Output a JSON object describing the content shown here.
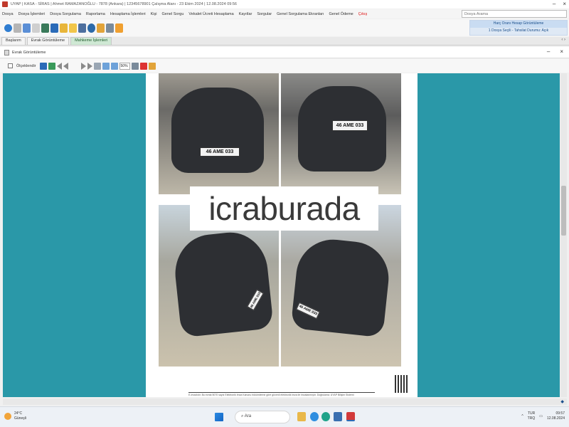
{
  "window": {
    "title": "UYAP | KASA - SİRAS | Ahmet RAMAZANOĞLU - 7878 (Ankara) | 12345678901 Çalışma Alanı - 23 Ekim 2024 | 12.08.2024 09:56"
  },
  "menu": {
    "items": [
      "Dosya",
      "Dosya İşlemleri",
      "Dosya Sorgulama",
      "Raporlama",
      "Hesaplama İşlemleri",
      "Kişi",
      "Genel Sorgu",
      "Vekalet Ücreti Hesaplama",
      "Kayıtlar",
      "Sorgular",
      "Genel Sorgulama Ekranları",
      "Genel Ödeme",
      "Çıkış"
    ],
    "last_item_color": "#d11111"
  },
  "search": {
    "placeholder": "Dosya Arama"
  },
  "right_panel": {
    "row1": "Harç Oranı Hesap Görüntüleme",
    "row2": "1 Dosya Seçili - Tahsilat Durumu: Açık"
  },
  "tabs": [
    "Başlarım",
    "Evrak Görüntüleme",
    "Mahkeme İşlemleri"
  ],
  "active_tab": "Mahkeme İşlemleri",
  "document_window": {
    "title": "Evrak Görüntüleme"
  },
  "viewer_toolbar": {
    "checkbox_label": "Ölçeklendir",
    "zoom": "50%"
  },
  "document": {
    "watermark": "icraburada",
    "footer_text": "E-İmzalıdır. Bu evrak 5070 sayılı Elektronik İmza Kanunu hükümlerine göre güvenli elektronik imza ile imzalanmıştır. Doğrulama: UYAP Bilişim Sistemi",
    "plates": {
      "photo1": "46 AME 033",
      "photo2": "46 AME 033",
      "photo3": "46 AME 033",
      "photo4": "46 AME 033"
    }
  },
  "taskbar": {
    "weather_temp": "24°C",
    "weather_desc": "Güneşli",
    "search_label": "Ara",
    "tray_lang": "TUR",
    "tray_region": "TRQ",
    "time": "09:57",
    "date": "12.08.2024"
  },
  "colors": {
    "viewer_bg": "#2a98a8",
    "accent": "#1a4f8c",
    "active_tab_bg": "#cfe8d4"
  }
}
